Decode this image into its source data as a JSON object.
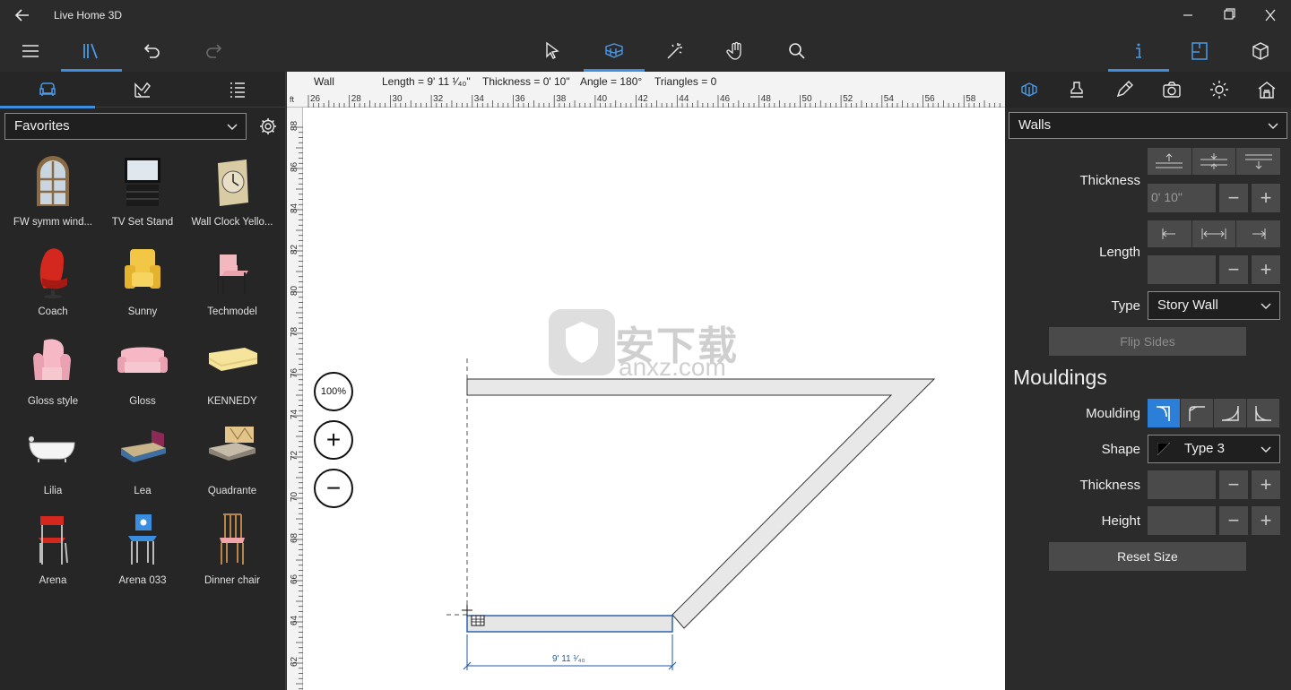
{
  "window": {
    "title": "Live Home 3D",
    "controls": [
      "minimize",
      "maximize",
      "close"
    ]
  },
  "toolbar": {
    "left": [
      "menu-icon",
      "library-icon",
      "undo-icon",
      "redo-icon"
    ],
    "center": [
      "select-icon",
      "wall-tool-icon",
      "wand-icon",
      "pan-icon",
      "search-icon"
    ],
    "right": [
      "info-icon",
      "floorplan-icon",
      "3d-box-icon"
    ],
    "active": [
      "library-icon",
      "wall-tool-icon",
      "info-icon"
    ]
  },
  "left_panel": {
    "tabs": [
      "furniture-icon",
      "materials-icon",
      "list-icon"
    ],
    "category": "Favorites",
    "items": [
      {
        "label": "FW symm wind..."
      },
      {
        "label": "TV Set Stand"
      },
      {
        "label": "Wall Clock Yello..."
      },
      {
        "label": "Coach"
      },
      {
        "label": "Sunny"
      },
      {
        "label": "Techmodel"
      },
      {
        "label": "Gloss style"
      },
      {
        "label": "Gloss"
      },
      {
        "label": "KENNEDY"
      },
      {
        "label": "Lilia"
      },
      {
        "label": "Lea"
      },
      {
        "label": "Quadrante"
      },
      {
        "label": "Arena"
      },
      {
        "label": "Arena 033"
      },
      {
        "label": "Dinner chair"
      }
    ]
  },
  "canvas": {
    "info": {
      "type": "Wall",
      "length": "Length = 9' 11 ¹⁄₄₀\"",
      "thickness": "Thickness = 0' 10\"",
      "angle": "Angle = 180°",
      "triangles": "Triangles = 0"
    },
    "ruler_unit": "ft",
    "h_ticks": [
      "26",
      "28",
      "30",
      "32",
      "34",
      "36",
      "38",
      "40",
      "42",
      "44",
      "46",
      "48",
      "50",
      "52",
      "54",
      "56",
      "58"
    ],
    "v_ticks": [
      "88",
      "86",
      "84",
      "82",
      "80",
      "78",
      "76",
      "74",
      "72",
      "70",
      "68",
      "66",
      "64",
      "62"
    ],
    "zoom": {
      "percent": "100%",
      "plus": "+",
      "minus": "−"
    },
    "dimension_label": "9' 11 ¹⁄₄₀",
    "watermark": {
      "cn": "安下载",
      "url": "anxz.com"
    }
  },
  "right_panel": {
    "tabs": [
      "wall-paint-icon",
      "stamp-icon",
      "pencil-icon",
      "camera-icon",
      "sun-icon",
      "house-icon"
    ],
    "object_type": "Walls",
    "thickness_label": "Thickness",
    "thickness_value": "0' 10\"",
    "length_label": "Length",
    "length_value": "",
    "type_label": "Type",
    "type_value": "Story Wall",
    "flip_sides": "Flip Sides",
    "mouldings_title": "Mouldings",
    "moulding_label": "Moulding",
    "shape_label": "Shape",
    "shape_value": "Type 3",
    "m_thickness_label": "Thickness",
    "m_height_label": "Height",
    "reset_size": "Reset Size",
    "accent": "#2b7fd8"
  }
}
